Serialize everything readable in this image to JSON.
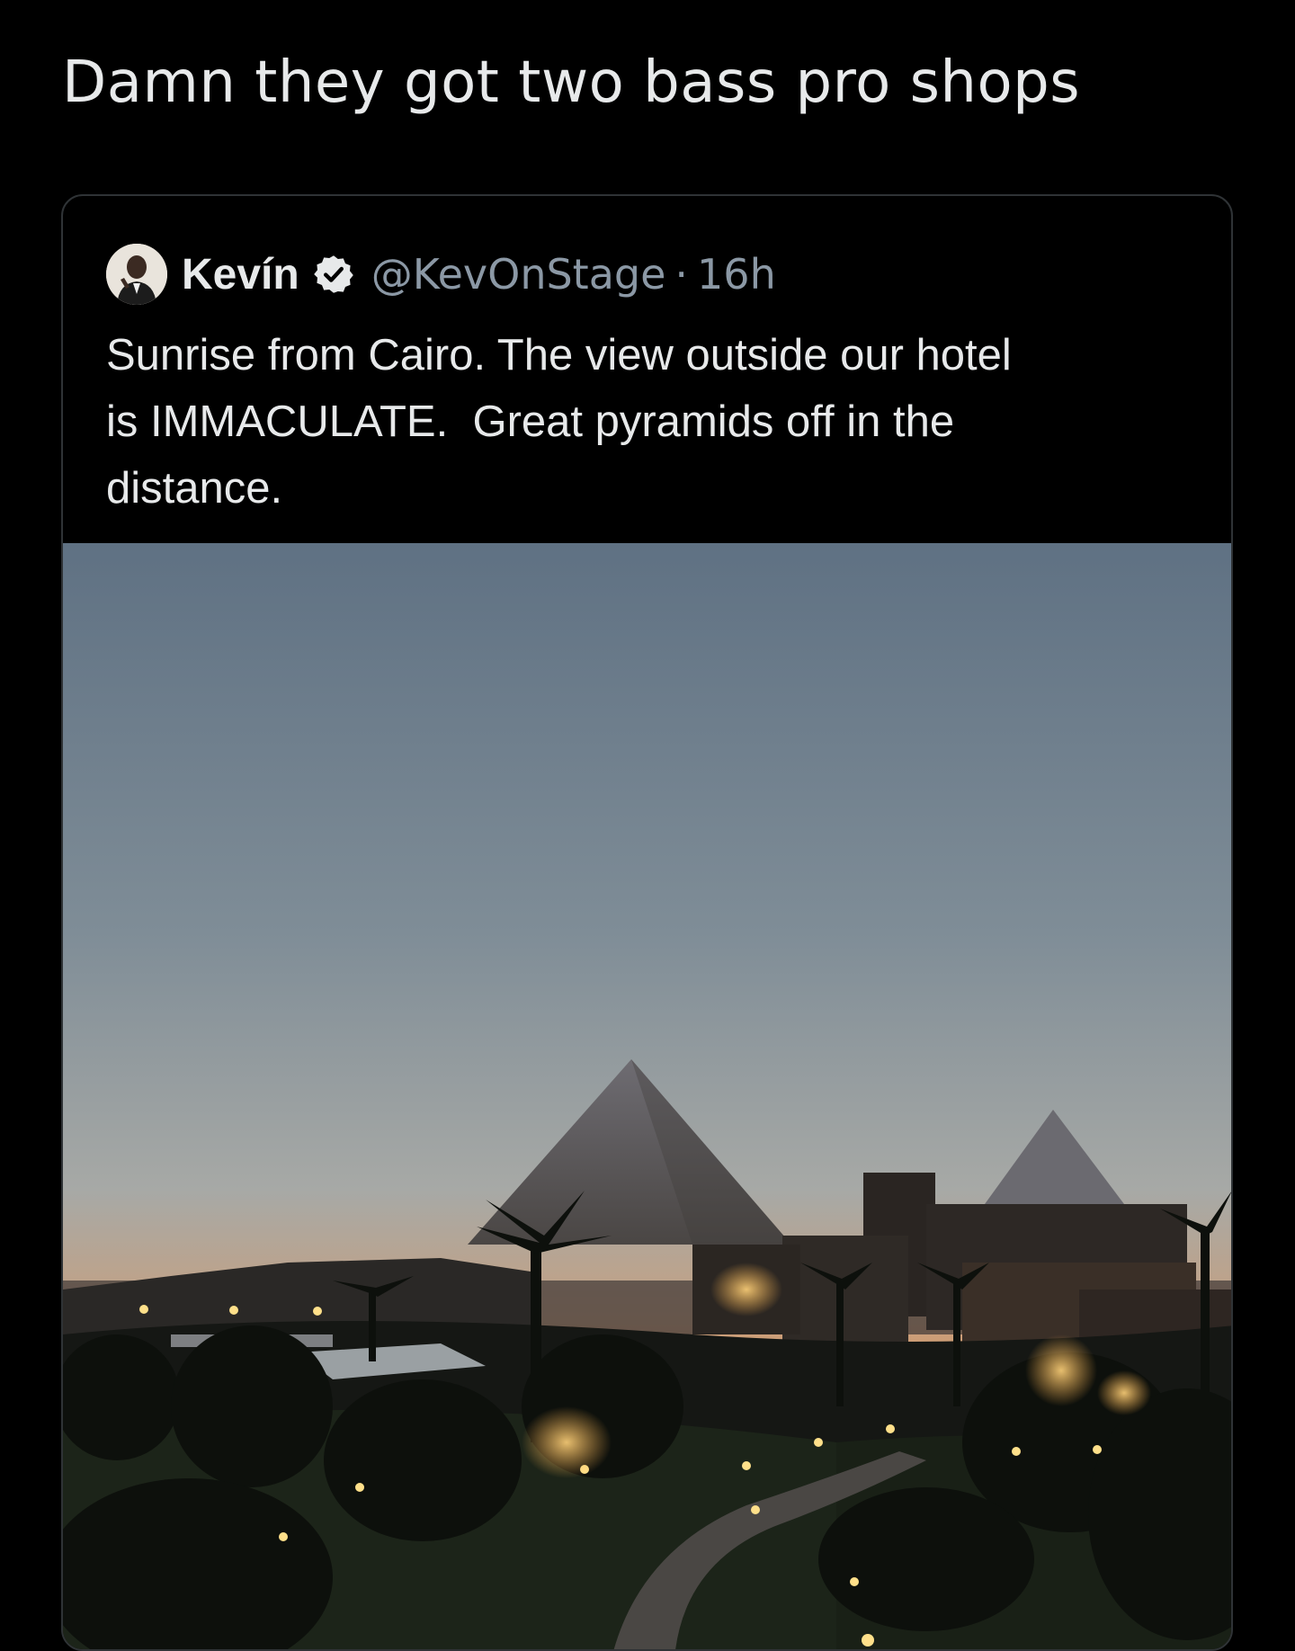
{
  "caption": "Damn they got two bass pro shops",
  "quoted_tweet": {
    "author_name": "Kevín",
    "handle": "@KevOnStage",
    "separator": "·",
    "timestamp": "16h",
    "text_lines": [
      "Sunrise from Cairo. The view outside our hotel",
      "is IMMACULATE.  Great pyramids off in the",
      "distance."
    ],
    "avatar_icon": "user-avatar",
    "verified_icon": "verified-badge-icon",
    "media_description_icon": "photo-sunrise-pyramids"
  },
  "colors": {
    "background": "#000000",
    "primary_text": "#e7e9ea",
    "secondary_text": "#8b98a5",
    "card_border": "#2f3336"
  }
}
